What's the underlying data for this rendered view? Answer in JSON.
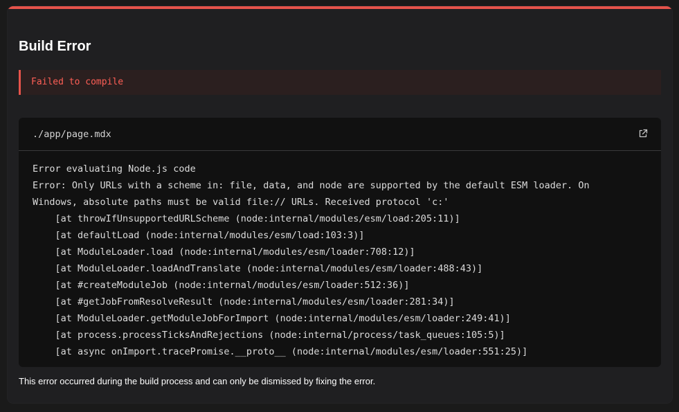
{
  "dialog": {
    "title": "Build Error",
    "error_banner": "Failed to compile",
    "file_path": "./app/page.mdx",
    "open_icon": "external-link-icon",
    "code_lines": [
      "Error evaluating Node.js code",
      "Error: Only URLs with a scheme in: file, data, and node are supported by the default ESM loader. On",
      "Windows, absolute paths must be valid file:// URLs. Received protocol 'c:'",
      "    [at throwIfUnsupportedURLScheme (node:internal/modules/esm/load:205:11)]",
      "    [at defaultLoad (node:internal/modules/esm/load:103:3)]",
      "    [at ModuleLoader.load (node:internal/modules/esm/loader:708:12)]",
      "    [at ModuleLoader.loadAndTranslate (node:internal/modules/esm/loader:488:43)]",
      "    [at #createModuleJob (node:internal/modules/esm/loader:512:36)]",
      "    [at #getJobFromResolveResult (node:internal/modules/esm/loader:281:34)]",
      "    [at ModuleLoader.getModuleJobForImport (node:internal/modules/esm/loader:249:41)]",
      "    [at process.processTicksAndRejections (node:internal/process/task_queues:105:5)]",
      "    [at async onImport.tracePromise.__proto__ (node:internal/modules/esm/loader:551:25)]"
    ],
    "footer_note": "This error occurred during the build process and can only be dismissed by fixing the error."
  },
  "colors": {
    "accent": "#e5534b",
    "error_text": "#ff5f56",
    "panel_bg": "#111111",
    "dialog_bg": "#1f1f21"
  }
}
